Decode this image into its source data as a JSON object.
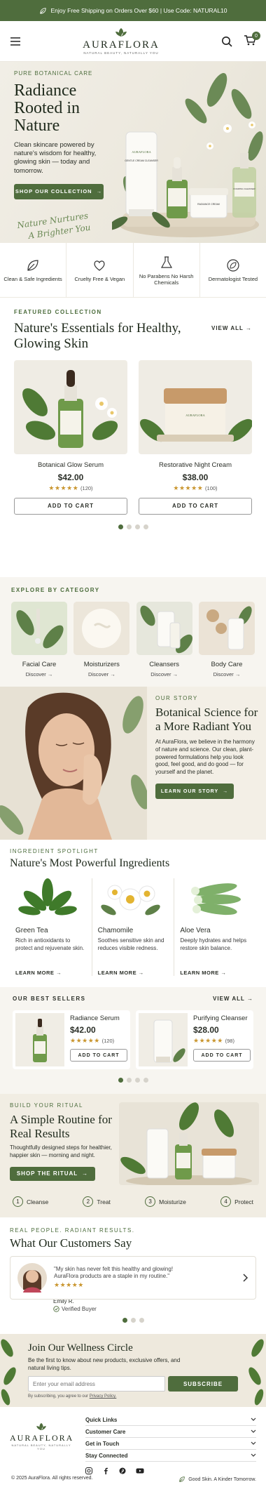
{
  "topbar": {
    "text": "Enjoy Free Shipping on Orders Over $60  |  Use Code: NATURAL10"
  },
  "header": {
    "logo_name": "AURAFLORA",
    "logo_tagline": "NATURAL BEAUTY, NATURALLY YOU",
    "cart_count": "0"
  },
  "hero": {
    "kicker": "PURE BOTANICAL CARE",
    "title": "Radiance Rooted in Nature",
    "body": "Clean skincare powered by nature's wisdom for healthy, glowing skin — today and tomorrow.",
    "cta": "SHOP OUR COLLECTION",
    "script_line1": "Nature Nurtures",
    "script_line2": "A Brighter You",
    "jar_brand": "AURAFLORA",
    "tube_label": "GENTLE CREAM CLEANSER",
    "cream_label": "RADIANCE CREAM",
    "bottle_label": "FOAMING CLEANSER"
  },
  "features": [
    {
      "label": "Clean & Safe Ingredients",
      "icon": "leaf-icon"
    },
    {
      "label": "Cruelty Free & Vegan",
      "icon": "heart-icon"
    },
    {
      "label": "No Parabens No Harsh Chemicals",
      "icon": "flask-icon"
    },
    {
      "label": "Dermatologist Tested",
      "icon": "leaf-outline-icon"
    }
  ],
  "featured": {
    "kicker": "FEATURED COLLECTION",
    "title": "Nature's Essentials for Healthy, Glowing Skin",
    "view_all": "VIEW ALL",
    "products": [
      {
        "name": "Botanical Glow Serum",
        "price": "$42.00",
        "rating": 5,
        "count": "(120)",
        "cta": "ADD TO CART"
      },
      {
        "name": "Restorative Night Cream",
        "price": "$38.00",
        "rating": 5,
        "count": "(100)",
        "cta": "ADD TO CART"
      }
    ]
  },
  "categories": {
    "kicker": "EXPLORE BY CATEGORY",
    "items": [
      {
        "name": "Facial Care",
        "link": "Discover"
      },
      {
        "name": "Moisturizers",
        "link": "Discover"
      },
      {
        "name": "Cleansers",
        "link": "Discover"
      },
      {
        "name": "Body Care",
        "link": "Discover"
      }
    ]
  },
  "story": {
    "kicker": "OUR STORY",
    "title": "Botanical Science for a More Radiant You",
    "body": "At AuraFlora, we believe in the harmony of nature and science. Our clean, plant-powered formulations help you look good, feel good, and do good — for yourself and the planet.",
    "cta": "LEARN OUR STORY"
  },
  "ingredients": {
    "kicker": "INGREDIENT SPOTLIGHT",
    "title": "Nature's Most Powerful Ingredients",
    "items": [
      {
        "name": "Green Tea",
        "desc": "Rich in antioxidants to protect and rejuvenate skin.",
        "link": "LEARN MORE"
      },
      {
        "name": "Chamomile",
        "desc": "Soothes sensitive skin and reduces visible redness.",
        "link": "LEARN MORE"
      },
      {
        "name": "Aloe Vera",
        "desc": "Deeply hydrates and helps restore skin balance.",
        "link": "LEARN MORE"
      }
    ]
  },
  "bestsellers": {
    "kicker": "OUR BEST SELLERS",
    "view_all": "VIEW ALL",
    "products": [
      {
        "name": "Radiance Serum",
        "price": "$42.00",
        "count": "(120)",
        "cta": "ADD TO CART"
      },
      {
        "name": "Purifying Cleanser",
        "price": "$28.00",
        "count": "(98)",
        "cta": "ADD TO CART"
      }
    ]
  },
  "ritual": {
    "kicker": "BUILD YOUR RITUAL",
    "title": "A Simple Routine for Real Results",
    "body": "Thoughtfully designed steps for healthier, happier skin — morning and night.",
    "cta": "SHOP THE RITUAL",
    "steps": [
      {
        "num": "1",
        "label": "Cleanse"
      },
      {
        "num": "2",
        "label": "Treat"
      },
      {
        "num": "3",
        "label": "Moisturize"
      },
      {
        "num": "4",
        "label": "Protect"
      }
    ]
  },
  "testimonials": {
    "kicker": "REAL PEOPLE. RADIANT RESULTS.",
    "title": "What Our Customers Say",
    "quote": "\"My skin has never felt this healthy and glowing! AuraFlora products are a staple in my routine.\"",
    "name": "Emily R.",
    "verified": "Verified Buyer"
  },
  "newsletter": {
    "title": "Join Our Wellness Circle",
    "body": "Be the first to know about new products, exclusive offers, and natural living tips.",
    "placeholder": "Enter your email address",
    "cta": "SUBSCRIBE",
    "fine_print_prefix": "By subscribing, you agree to our ",
    "fine_print_link": "Privacy Policy."
  },
  "footer": {
    "logo_name": "AURAFLORA",
    "logo_tagline": "NATURAL BEAUTY, NATURALLY YOU",
    "links": [
      "Quick Links",
      "Customer Care",
      "Get in Touch",
      "Stay Connected"
    ],
    "copyright": "© 2025 AuraFlora. All rights reserved.",
    "tagline": "Good Skin. A Kinder Tomorrow."
  },
  "colors": {
    "brand": "#4f6d3d",
    "star": "#c9952e",
    "bg": "#f7f5f0"
  }
}
